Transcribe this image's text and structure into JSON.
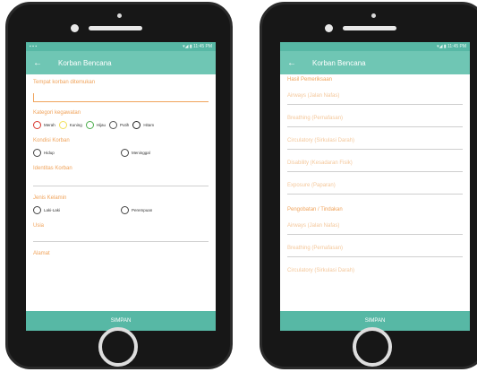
{
  "left_screen": {
    "status_left": "▪ ▪ ▪",
    "status_right": "▾◢ ▮ 11:45 PM",
    "back_icon": "←",
    "title": "Korban Bencana",
    "fields": {
      "tempat_label": "Tempat korban ditemukan",
      "kategori_label": "Kategori kegawatan",
      "kondisi_label": "Kondisi Korban",
      "identitas_label": "Identitas Korban",
      "jenis_kelamin_label": "Jenis Kelamin",
      "usia_label": "Usia",
      "alamat_label": "Alamat"
    },
    "kategori_options": [
      {
        "label": "Merah",
        "color": "#d9342b"
      },
      {
        "label": "Kuning",
        "color": "#f2df5a"
      },
      {
        "label": "Hijau",
        "color": "#4cae4c"
      },
      {
        "label": "Putih",
        "color": "#555555"
      },
      {
        "label": "Hitam",
        "color": "#222222"
      }
    ],
    "kondisi_options": [
      "Hidup",
      "Meninggal"
    ],
    "gender_options": [
      "Laki-Laki",
      "Perempuan"
    ],
    "save_label": "SIMPAN"
  },
  "right_screen": {
    "status_right": "▾◢ ▮ 11:45 PM",
    "back_icon": "←",
    "title": "Korban Bencana",
    "section_hasil": "Hasil Pemeriksaan",
    "hasil_fields": [
      "Airways (Jalan Nafas)",
      "Breathing (Pernafasan)",
      "Circulatory (Sirkulasi Darah)",
      "Disability (Kesadaran Fisik)",
      "Exposure (Paparan)"
    ],
    "section_pengobatan": "Pengobatan / Tindakan",
    "pengobatan_fields": [
      "Airways (Jalan Nafas)",
      "Breathing (Pernafasan)",
      "Circulatory (Sirkulasi Darah)"
    ],
    "save_label": "SIMPAN"
  }
}
